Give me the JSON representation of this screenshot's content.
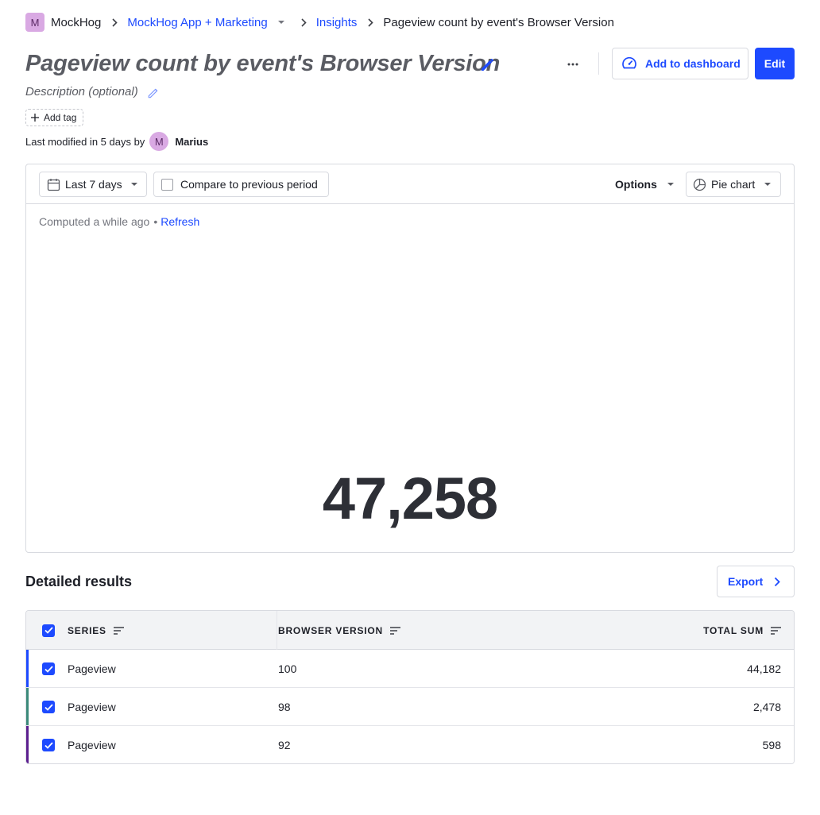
{
  "breadcrumb": {
    "avatar_letter": "M",
    "org": "MockHog",
    "project": "MockHog App + Marketing",
    "section": "Insights",
    "current": "Pageview count by event's Browser Version"
  },
  "insight": {
    "title": "Pageview count by event's Browser Version",
    "description_placeholder": "Description (optional)",
    "add_tag_label": "Add tag",
    "last_modified_text": "Last modified in 5 days by",
    "modifier_initial": "M",
    "modifier_name": "Marius"
  },
  "actions": {
    "add_to_dashboard_label": "Add to dashboard",
    "edit_label": "Edit"
  },
  "toolbar": {
    "date_range": "Last 7 days",
    "compare_label": "Compare to previous period",
    "compare_checked": false,
    "options_label": "Options",
    "chart_type_label": "Pie chart"
  },
  "status": {
    "computed_text": "Computed a while ago",
    "separator": "•",
    "refresh_label": "Refresh"
  },
  "result": {
    "total_value": "47,258"
  },
  "details": {
    "heading": "Detailed results",
    "export_label": "Export",
    "columns": {
      "series": "SERIES",
      "browser_version": "BROWSER VERSION",
      "total_sum": "TOTAL SUM"
    },
    "rows": [
      {
        "series": "Pageview",
        "browser_version": "100",
        "total_sum": "44,182",
        "color": "#1d4aff",
        "checked": true
      },
      {
        "series": "Pageview",
        "browser_version": "98",
        "total_sum": "2,478",
        "color": "#3b8a7a",
        "checked": true
      },
      {
        "series": "Pageview",
        "browser_version": "92",
        "total_sum": "598",
        "color": "#5c1f8f",
        "checked": true
      }
    ]
  },
  "colors": {
    "accent": "#1d4aff",
    "avatar_bg": "#d9a9e3"
  }
}
